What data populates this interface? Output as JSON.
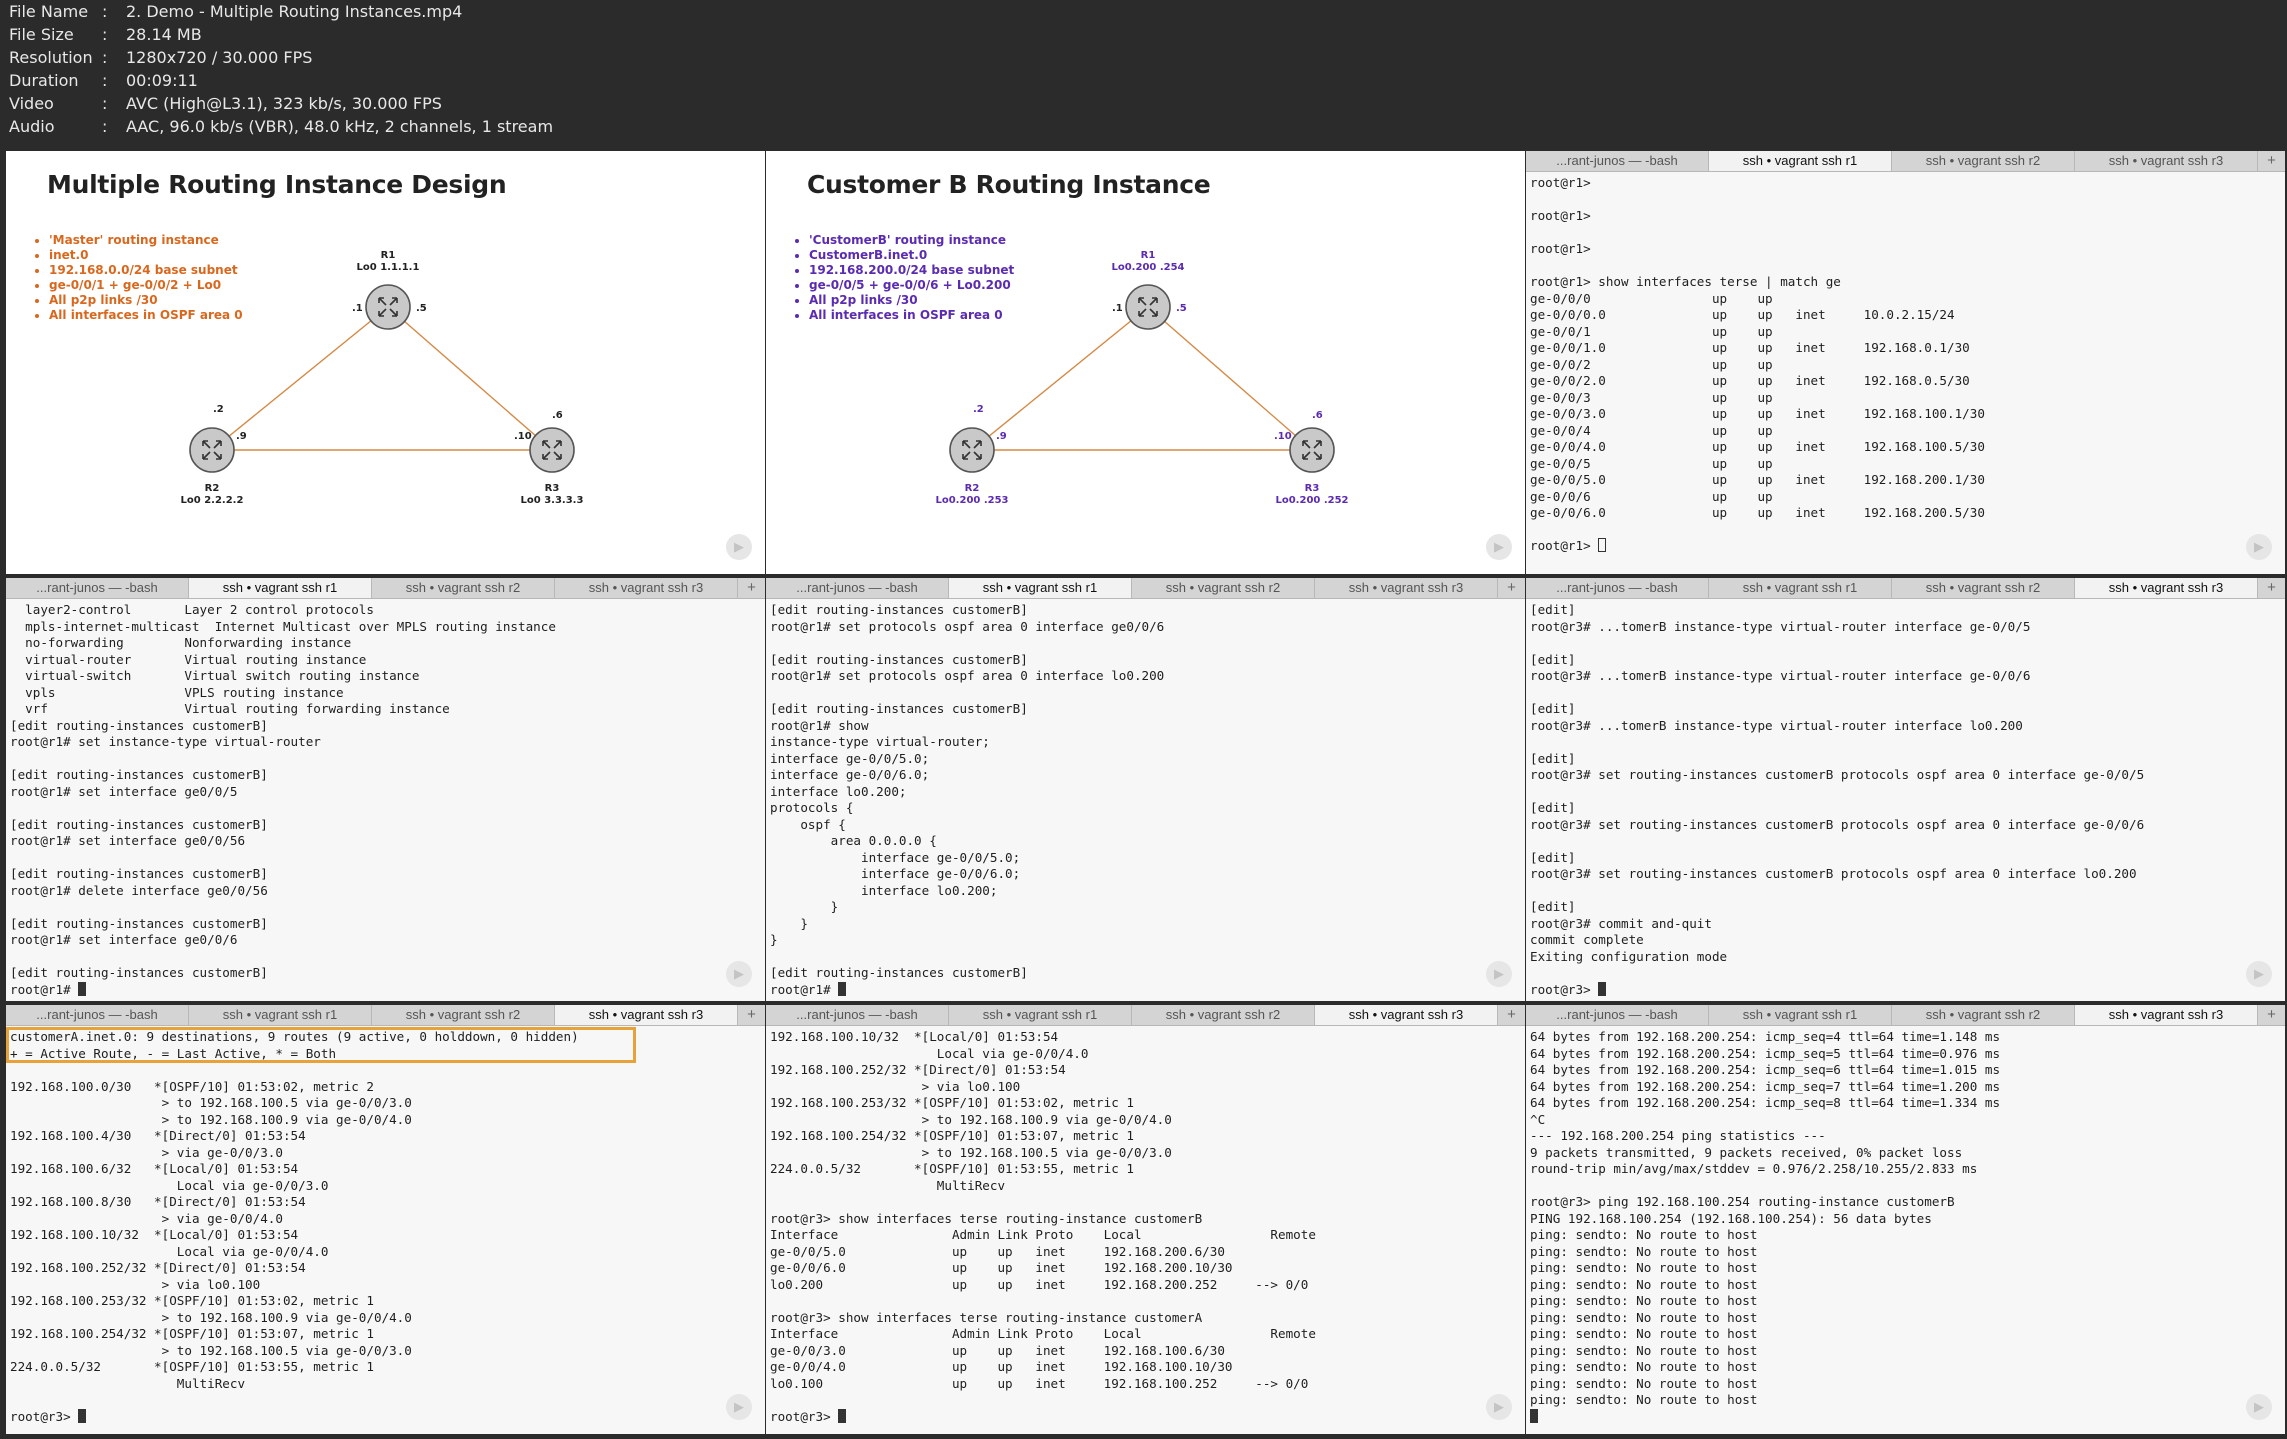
{
  "file_info": {
    "rows": [
      {
        "label": "File Name",
        "value": "2. Demo - Multiple Routing Instances.mp4"
      },
      {
        "label": "File Size",
        "value": "28.14 MB"
      },
      {
        "label": "Resolution",
        "value": "1280x720 / 30.000 FPS"
      },
      {
        "label": "Duration",
        "value": "00:09:11"
      },
      {
        "label": "Video",
        "value": "AVC (High@L3.1), 323 kb/s, 30.000 FPS"
      },
      {
        "label": "Audio",
        "value": "AAC, 96.0 kb/s (VBR), 48.0 kHz, 2 channels, 1 stream"
      }
    ],
    "separator": ":"
  },
  "tabs": [
    "...rant-junos — -bash",
    "ssh • vagrant ssh r1",
    "ssh • vagrant ssh r2",
    "ssh • vagrant ssh r3"
  ],
  "tab_plus": "+",
  "play_glyph": "▶",
  "colors": {
    "accent_orange": "#d9681e",
    "accent_purple": "#5b2bb0",
    "highlight": "#e8a23a",
    "link": "#c87a3a"
  },
  "slides": [
    {
      "title": "Multiple Routing Instance Design",
      "bullet_color": "#d9681e",
      "bullets": [
        "'Master' routing instance",
        "inet.0",
        "192.168.0.0/24 base subnet",
        "ge-0/0/1 + ge-0/0/2 + Lo0",
        "All p2p links /30",
        "All interfaces in OSPF area 0"
      ],
      "r1_name": "R1",
      "r1_lo": "Lo0 1.1.1.1",
      "r2_name": "R2",
      "r2_lo": "Lo0 2.2.2.2",
      "r3_name": "R3",
      "r3_lo": "Lo0 3.3.3.3",
      "addr_r1_left": ".1",
      "addr_r1_right": ".5",
      "addr_r2_up": ".2",
      "addr_r2_right": ".9",
      "addr_r3_up": ".6",
      "addr_r3_left": ".10",
      "label_color": "#222222"
    },
    {
      "title": "Customer B Routing Instance",
      "bullet_color": "#5b2bb0",
      "bullets": [
        "'CustomerB' routing instance",
        "CustomerB.inet.0",
        "192.168.200.0/24 base subnet",
        "ge-0/0/5 + ge-0/0/6 + Lo0.200",
        "All p2p links /30",
        "All interfaces in OSPF area 0"
      ],
      "r1_name": "R1",
      "r1_lo": "Lo0.200 .254",
      "r2_name": "R2",
      "r2_lo": "Lo0.200 .253",
      "r3_name": "R3",
      "r3_lo": "Lo0.200 .252",
      "addr_r1_left": ".1",
      "addr_r1_right": ".5",
      "addr_r2_up": ".2",
      "addr_r2_right": ".9",
      "addr_r3_up": ".6",
      "addr_r3_left": ".10",
      "label_color": "#5b2bb0"
    }
  ],
  "terminals": {
    "t3": {
      "active_tab": 1,
      "text": "root@r1>\n\nroot@r1>\n\nroot@r1>\n\nroot@r1> show interfaces terse | match ge\nge-0/0/0                up    up\nge-0/0/0.0              up    up   inet     10.0.2.15/24\nge-0/0/1                up    up\nge-0/0/1.0              up    up   inet     192.168.0.1/30\nge-0/0/2                up    up\nge-0/0/2.0              up    up   inet     192.168.0.5/30\nge-0/0/3                up    up\nge-0/0/3.0              up    up   inet     192.168.100.1/30\nge-0/0/4                up    up\nge-0/0/4.0              up    up   inet     192.168.100.5/30\nge-0/0/5                up    up\nge-0/0/5.0              up    up   inet     192.168.200.1/30\nge-0/0/6                up    up\nge-0/0/6.0              up    up   inet     192.168.200.5/30\n\nroot@r1> "
    },
    "t4": {
      "active_tab": 1,
      "text": "  layer2-control       Layer 2 control protocols\n  mpls-internet-multicast  Internet Multicast over MPLS routing instance\n  no-forwarding        Nonforwarding instance\n  virtual-router       Virtual routing instance\n  virtual-switch       Virtual switch routing instance\n  vpls                 VPLS routing instance\n  vrf                  Virtual routing forwarding instance\n[edit routing-instances customerB]\nroot@r1# set instance-type virtual-router\n\n[edit routing-instances customerB]\nroot@r1# set interface ge0/0/5\n\n[edit routing-instances customerB]\nroot@r1# set interface ge0/0/56\n\n[edit routing-instances customerB]\nroot@r1# delete interface ge0/0/56\n\n[edit routing-instances customerB]\nroot@r1# set interface ge0/0/6\n\n[edit routing-instances customerB]\nroot@r1# "
    },
    "t5": {
      "active_tab": 1,
      "text": "[edit routing-instances customerB]\nroot@r1# set protocols ospf area 0 interface ge0/0/6\n\n[edit routing-instances customerB]\nroot@r1# set protocols ospf area 0 interface lo0.200\n\n[edit routing-instances customerB]\nroot@r1# show\ninstance-type virtual-router;\ninterface ge-0/0/5.0;\ninterface ge-0/0/6.0;\ninterface lo0.200;\nprotocols {\n    ospf {\n        area 0.0.0.0 {\n            interface ge-0/0/5.0;\n            interface ge-0/0/6.0;\n            interface lo0.200;\n        }\n    }\n}\n\n[edit routing-instances customerB]\nroot@r1# "
    },
    "t6": {
      "active_tab": 3,
      "text": "[edit]\nroot@r3# ...tomerB instance-type virtual-router interface ge-0/0/5\n\n[edit]\nroot@r3# ...tomerB instance-type virtual-router interface ge-0/0/6\n\n[edit]\nroot@r3# ...tomerB instance-type virtual-router interface lo0.200\n\n[edit]\nroot@r3# set routing-instances customerB protocols ospf area 0 interface ge-0/0/5\n\n[edit]\nroot@r3# set routing-instances customerB protocols ospf area 0 interface ge-0/0/6\n\n[edit]\nroot@r3# set routing-instances customerB protocols ospf area 0 interface lo0.200\n\n[edit]\nroot@r3# commit and-quit\ncommit complete\nExiting configuration mode\n\nroot@r3> "
    },
    "t7": {
      "active_tab": 3,
      "text": "customerA.inet.0: 9 destinations, 9 routes (9 active, 0 holddown, 0 hidden)\n+ = Active Route, - = Last Active, * = Both\n\n192.168.100.0/30   *[OSPF/10] 01:53:02, metric 2\n                    > to 192.168.100.5 via ge-0/0/3.0\n                    > to 192.168.100.9 via ge-0/0/4.0\n192.168.100.4/30   *[Direct/0] 01:53:54\n                    > via ge-0/0/3.0\n192.168.100.6/32   *[Local/0] 01:53:54\n                      Local via ge-0/0/3.0\n192.168.100.8/30   *[Direct/0] 01:53:54\n                    > via ge-0/0/4.0\n192.168.100.10/32  *[Local/0] 01:53:54\n                      Local via ge-0/0/4.0\n192.168.100.252/32 *[Direct/0] 01:53:54\n                    > via lo0.100\n192.168.100.253/32 *[OSPF/10] 01:53:02, metric 1\n                    > to 192.168.100.9 via ge-0/0/4.0\n192.168.100.254/32 *[OSPF/10] 01:53:07, metric 1\n                    > to 192.168.100.5 via ge-0/0/3.0\n224.0.0.5/32       *[OSPF/10] 01:53:55, metric 1\n                      MultiRecv\n\nroot@r3> "
    },
    "t8": {
      "active_tab": 3,
      "text": "192.168.100.10/32  *[Local/0] 01:53:54\n                      Local via ge-0/0/4.0\n192.168.100.252/32 *[Direct/0] 01:53:54\n                    > via lo0.100\n192.168.100.253/32 *[OSPF/10] 01:53:02, metric 1\n                    > to 192.168.100.9 via ge-0/0/4.0\n192.168.100.254/32 *[OSPF/10] 01:53:07, metric 1\n                    > to 192.168.100.5 via ge-0/0/3.0\n224.0.0.5/32       *[OSPF/10] 01:53:55, metric 1\n                      MultiRecv\n\nroot@r3> show interfaces terse routing-instance customerB\nInterface               Admin Link Proto    Local                 Remote\nge-0/0/5.0              up    up   inet     192.168.200.6/30\nge-0/0/6.0              up    up   inet     192.168.200.10/30\nlo0.200                 up    up   inet     192.168.200.252     --> 0/0\n\nroot@r3> show interfaces terse routing-instance customerA\nInterface               Admin Link Proto    Local                 Remote\nge-0/0/3.0              up    up   inet     192.168.100.6/30\nge-0/0/4.0              up    up   inet     192.168.100.10/30\nlo0.100                 up    up   inet     192.168.100.252     --> 0/0\n\nroot@r3> "
    },
    "t9": {
      "active_tab": 3,
      "text": "64 bytes from 192.168.200.254: icmp_seq=4 ttl=64 time=1.148 ms\n64 bytes from 192.168.200.254: icmp_seq=5 ttl=64 time=0.976 ms\n64 bytes from 192.168.200.254: icmp_seq=6 ttl=64 time=1.015 ms\n64 bytes from 192.168.200.254: icmp_seq=7 ttl=64 time=1.200 ms\n64 bytes from 192.168.200.254: icmp_seq=8 ttl=64 time=1.334 ms\n^C\n--- 192.168.200.254 ping statistics ---\n9 packets transmitted, 9 packets received, 0% packet loss\nround-trip min/avg/max/stddev = 0.976/2.258/10.255/2.833 ms\n\nroot@r3> ping 192.168.100.254 routing-instance customerB\nPING 192.168.100.254 (192.168.100.254): 56 data bytes\nping: sendto: No route to host\nping: sendto: No route to host\nping: sendto: No route to host\nping: sendto: No route to host\nping: sendto: No route to host\nping: sendto: No route to host\nping: sendto: No route to host\nping: sendto: No route to host\nping: sendto: No route to host\nping: sendto: No route to host\nping: sendto: No route to host\n"
    }
  }
}
